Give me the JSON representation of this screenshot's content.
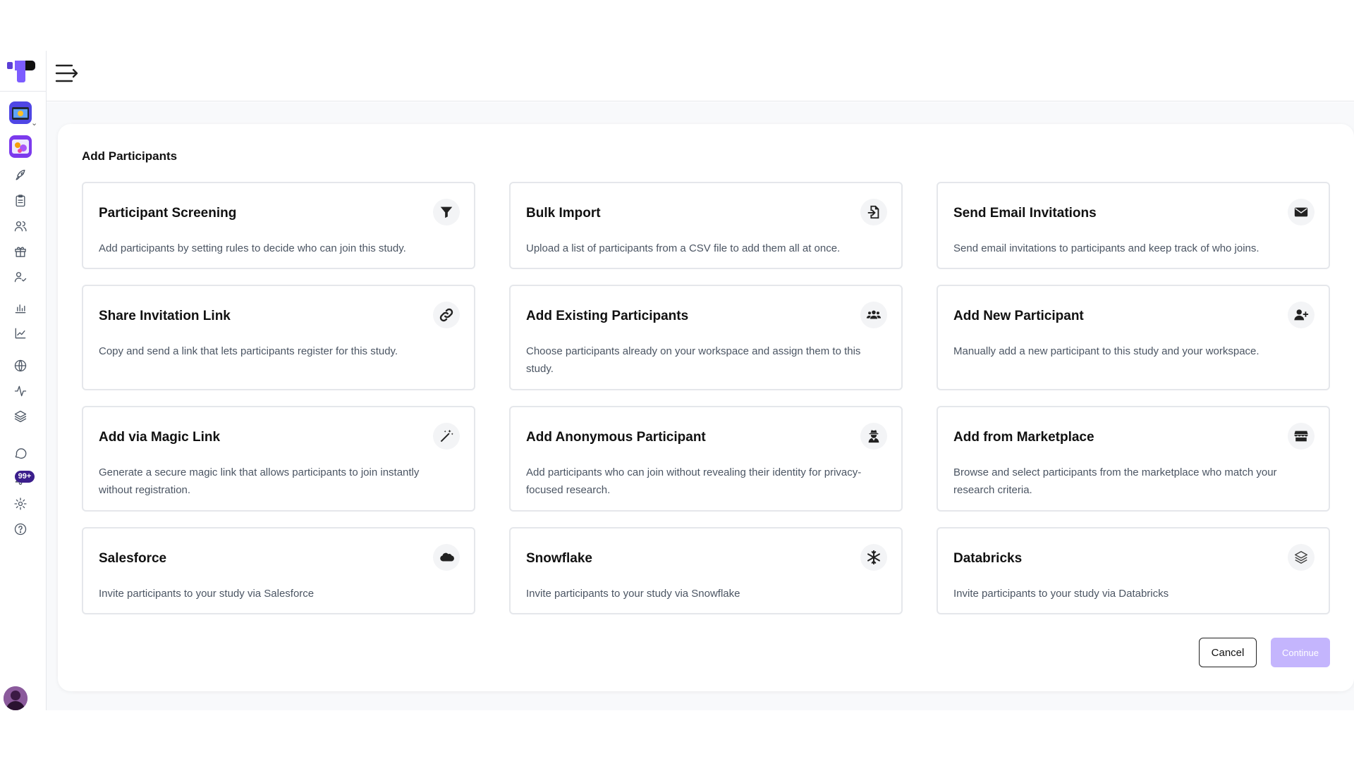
{
  "panel": {
    "title": "Add Participants"
  },
  "sidebar": {
    "notifications_badge": "99+"
  },
  "cards": [
    {
      "title": "Participant Screening",
      "description": "Add participants by setting rules to decide who can join this study.",
      "icon": "filter-icon"
    },
    {
      "title": "Bulk Import",
      "description": "Upload a list of participants from a CSV file to add them all at once.",
      "icon": "file-import-icon"
    },
    {
      "title": "Send Email Invitations",
      "description": "Send email invitations to participants and keep track of who joins.",
      "icon": "envelope-icon"
    },
    {
      "title": "Share Invitation Link",
      "description": "Copy and send a link that lets participants register for this study.",
      "icon": "link-icon"
    },
    {
      "title": "Add Existing Participants",
      "description": "Choose participants already on your workspace and assign them to this study.",
      "icon": "users-icon"
    },
    {
      "title": "Add New Participant",
      "description": "Manually add a new participant to this study and your workspace.",
      "icon": "user-plus-icon"
    },
    {
      "title": "Add via Magic Link",
      "description": "Generate a secure magic link that allows participants to join instantly without registration.",
      "icon": "magic-wand-icon"
    },
    {
      "title": "Add Anonymous Participant",
      "description": "Add participants who can join without revealing their identity for privacy-focused research.",
      "icon": "user-secret-icon"
    },
    {
      "title": "Add from Marketplace",
      "description": "Browse and select participants from the marketplace who match your research criteria.",
      "icon": "store-icon"
    },
    {
      "title": "Salesforce",
      "description": "Invite participants to your study via Salesforce",
      "icon": "salesforce-cloud-icon"
    },
    {
      "title": "Snowflake",
      "description": "Invite participants to your study via Snowflake",
      "icon": "snowflake-icon"
    },
    {
      "title": "Databricks",
      "description": "Invite participants to your study via Databricks",
      "icon": "databricks-layers-icon"
    }
  ],
  "actions": {
    "cancel_label": "Cancel",
    "continue_label": "Continue"
  }
}
